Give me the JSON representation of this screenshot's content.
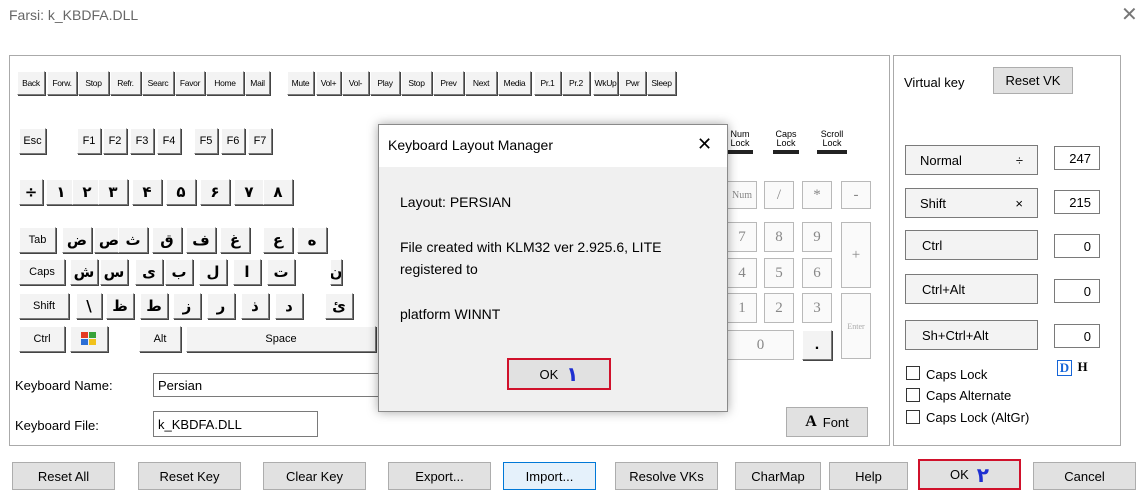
{
  "window": {
    "title": "Farsi: k_KBDFA.DLL"
  },
  "media_keys": [
    "Back",
    "Forw.",
    "Stop",
    "Refr.",
    "Searc",
    "Favor",
    "Home",
    "Mail",
    "Mute",
    "Vol+",
    "Vol-",
    "Play",
    "Stop",
    "Prev",
    "Next",
    "Media",
    "Pr.1",
    "Pr.2",
    "WkUp",
    "Pwr",
    "Sleep"
  ],
  "fkeys": {
    "esc": "Esc",
    "f": [
      "F1",
      "F2",
      "F3",
      "F4",
      "F5",
      "F6",
      "F7"
    ]
  },
  "locks": {
    "num": "Num Lock",
    "caps": "Caps Lock",
    "scroll": "Scroll Lock"
  },
  "row1": [
    "÷",
    "۱",
    "۲",
    "۳",
    "۴",
    "۵",
    "۶",
    "۷",
    "۸"
  ],
  "row2": {
    "tab": "Tab",
    "keys": [
      "ض",
      "ص",
      "ث",
      "ق",
      "ف",
      "غ",
      "ع",
      "ه"
    ]
  },
  "row3": {
    "caps": "Caps",
    "keys": [
      "ش",
      "س",
      "ی",
      "ب",
      "ل",
      "ا",
      "ت",
      "ن"
    ]
  },
  "row4": {
    "shift": "Shift",
    "keys": [
      "\\",
      "ظ",
      "ط",
      "ز",
      "ر",
      "ذ",
      "د",
      "ئ"
    ]
  },
  "row5": {
    "ctrl": "Ctrl",
    "alt": "Alt",
    "space": "Space"
  },
  "numpad": {
    "num": "Num",
    "div": "/",
    "mul": "*",
    "minus": "-",
    "n7": "7",
    "n8": "8",
    "n9": "9",
    "plus": "+",
    "n4": "4",
    "n5": "5",
    "n6": "6",
    "n1": "1",
    "n2": "2",
    "n3": "3",
    "enter": "Enter",
    "n0": "0",
    "dot": "."
  },
  "keyboard_name": {
    "label": "Keyboard Name:",
    "value": "Persian"
  },
  "keyboard_file": {
    "label": "Keyboard File:",
    "value": "k_KBDFA.DLL"
  },
  "font_button": {
    "glyph": "A",
    "label": "Font"
  },
  "right_panel": {
    "virtual_key_label": "Virtual key",
    "reset_vk": "Reset VK",
    "states": [
      {
        "label": "Normal",
        "char": "÷",
        "code": "247"
      },
      {
        "label": "Shift",
        "char": "×",
        "code": "215"
      },
      {
        "label": "Ctrl",
        "char": "",
        "code": "0"
      },
      {
        "label": "Ctrl+Alt",
        "char": "",
        "code": "0"
      },
      {
        "label": "Sh+Ctrl+Alt",
        "char": "",
        "code": "0"
      }
    ],
    "checkboxes": [
      "Caps Lock",
      "Caps Alternate",
      "Caps Lock (AltGr)"
    ],
    "dh": [
      "D",
      "H"
    ]
  },
  "bottom_buttons": [
    "Reset All",
    "Reset Key",
    "Clear Key",
    "Export...",
    "Import...",
    "Resolve VKs",
    "CharMap",
    "Help",
    "OK",
    "Cancel"
  ],
  "annotations": {
    "dialog_ok": "۱",
    "main_ok": "۲",
    "color": "#d0112b"
  },
  "dialog": {
    "title": "Keyboard Layout Manager",
    "layout": "Layout: PERSIAN",
    "created_line1": "File created with KLM32 ver 2.925.6, LITE",
    "created_line2": "registered to",
    "platform": "platform WINNT",
    "ok": "OK"
  }
}
